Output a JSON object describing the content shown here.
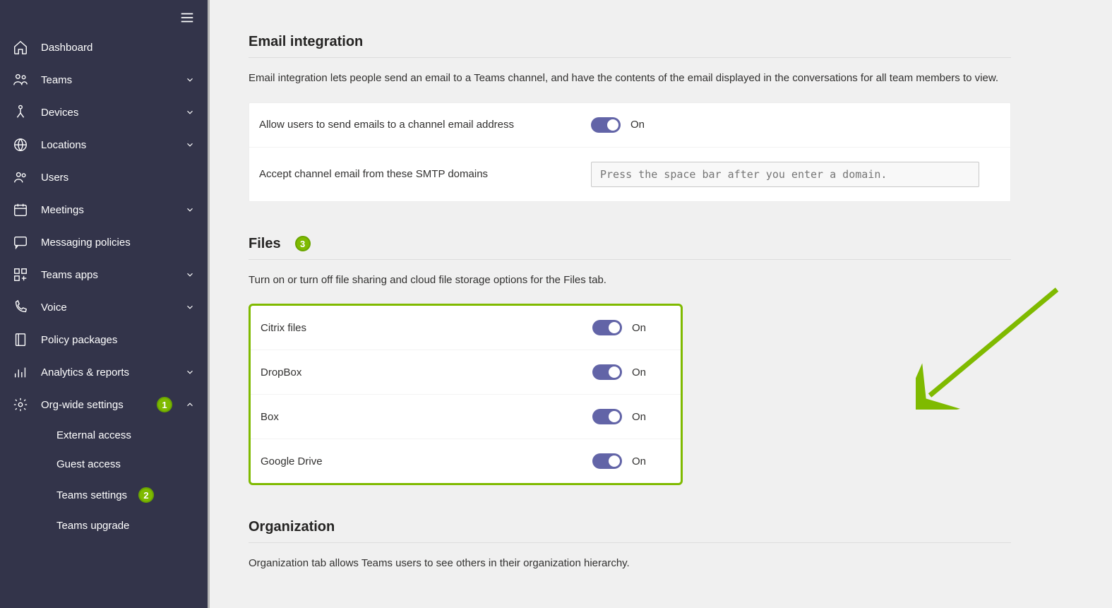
{
  "sidebar": {
    "items": [
      {
        "label": "Dashboard"
      },
      {
        "label": "Teams"
      },
      {
        "label": "Devices"
      },
      {
        "label": "Locations"
      },
      {
        "label": "Users"
      },
      {
        "label": "Meetings"
      },
      {
        "label": "Messaging policies"
      },
      {
        "label": "Teams apps"
      },
      {
        "label": "Voice"
      },
      {
        "label": "Policy packages"
      },
      {
        "label": "Analytics & reports"
      },
      {
        "label": "Org-wide settings",
        "badge": "1"
      }
    ],
    "subitems": [
      {
        "label": "External access"
      },
      {
        "label": "Guest access"
      },
      {
        "label": "Teams settings",
        "badge": "2"
      },
      {
        "label": "Teams upgrade"
      }
    ]
  },
  "email_section": {
    "title": "Email integration",
    "desc": "Email integration lets people send an email to a Teams channel, and have the contents of the email displayed in the conversations for all team members to view.",
    "allow_label": "Allow users to send emails to a channel email address",
    "allow_state": "On",
    "smtp_label": "Accept channel email from these SMTP domains",
    "smtp_placeholder": "Press the space bar after you enter a domain."
  },
  "files_section": {
    "title": "Files",
    "badge": "3",
    "desc": "Turn on or turn off file sharing and cloud file storage options for the Files tab.",
    "providers": [
      {
        "label": "Citrix files",
        "state": "On"
      },
      {
        "label": "DropBox",
        "state": "On"
      },
      {
        "label": "Box",
        "state": "On"
      },
      {
        "label": "Google Drive",
        "state": "On"
      }
    ]
  },
  "org_section": {
    "title": "Organization",
    "desc": "Organization tab allows Teams users to see others in their organization hierarchy."
  }
}
